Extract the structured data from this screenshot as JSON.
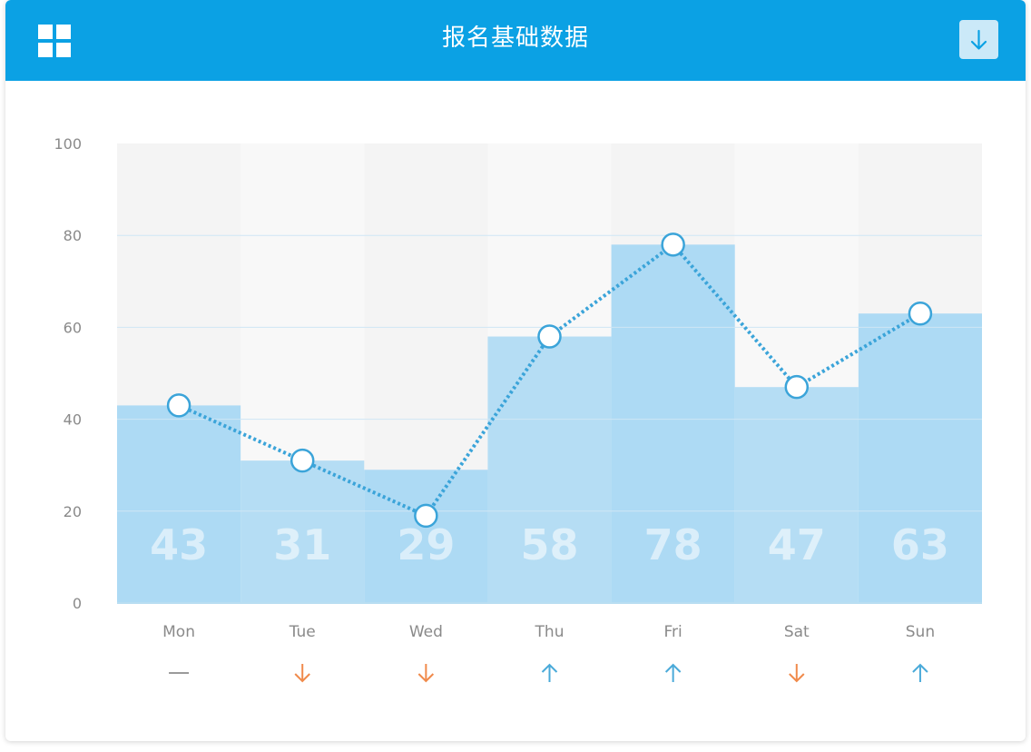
{
  "header": {
    "title": "报名基础数据",
    "menu_icon": "grid-icon",
    "download_icon": "download-arrow-icon",
    "background_color": "#0ba1e4"
  },
  "chart_data": {
    "type": "bar",
    "categories": [
      "Mon",
      "Tue",
      "Wed",
      "Thu",
      "Fri",
      "Sat",
      "Sun"
    ],
    "values": [
      43,
      31,
      29,
      58,
      78,
      47,
      63
    ],
    "line_values": [
      43,
      31,
      19,
      58,
      78,
      47,
      63
    ],
    "data_labels": [
      "43",
      "31",
      "29",
      "58",
      "78",
      "47",
      "63"
    ],
    "trend": [
      "flat",
      "down",
      "down",
      "up",
      "up",
      "down",
      "up"
    ],
    "ylim": [
      0,
      100
    ],
    "yticks": [
      "0",
      "20",
      "40",
      "60",
      "80",
      "100"
    ],
    "grid": true,
    "bar_color": "#a9d8f3",
    "line_color": "#3ba4d9",
    "up_color": "#4aaad9",
    "down_color": "#f08a4b",
    "flat_color": "#9a9a9a"
  }
}
